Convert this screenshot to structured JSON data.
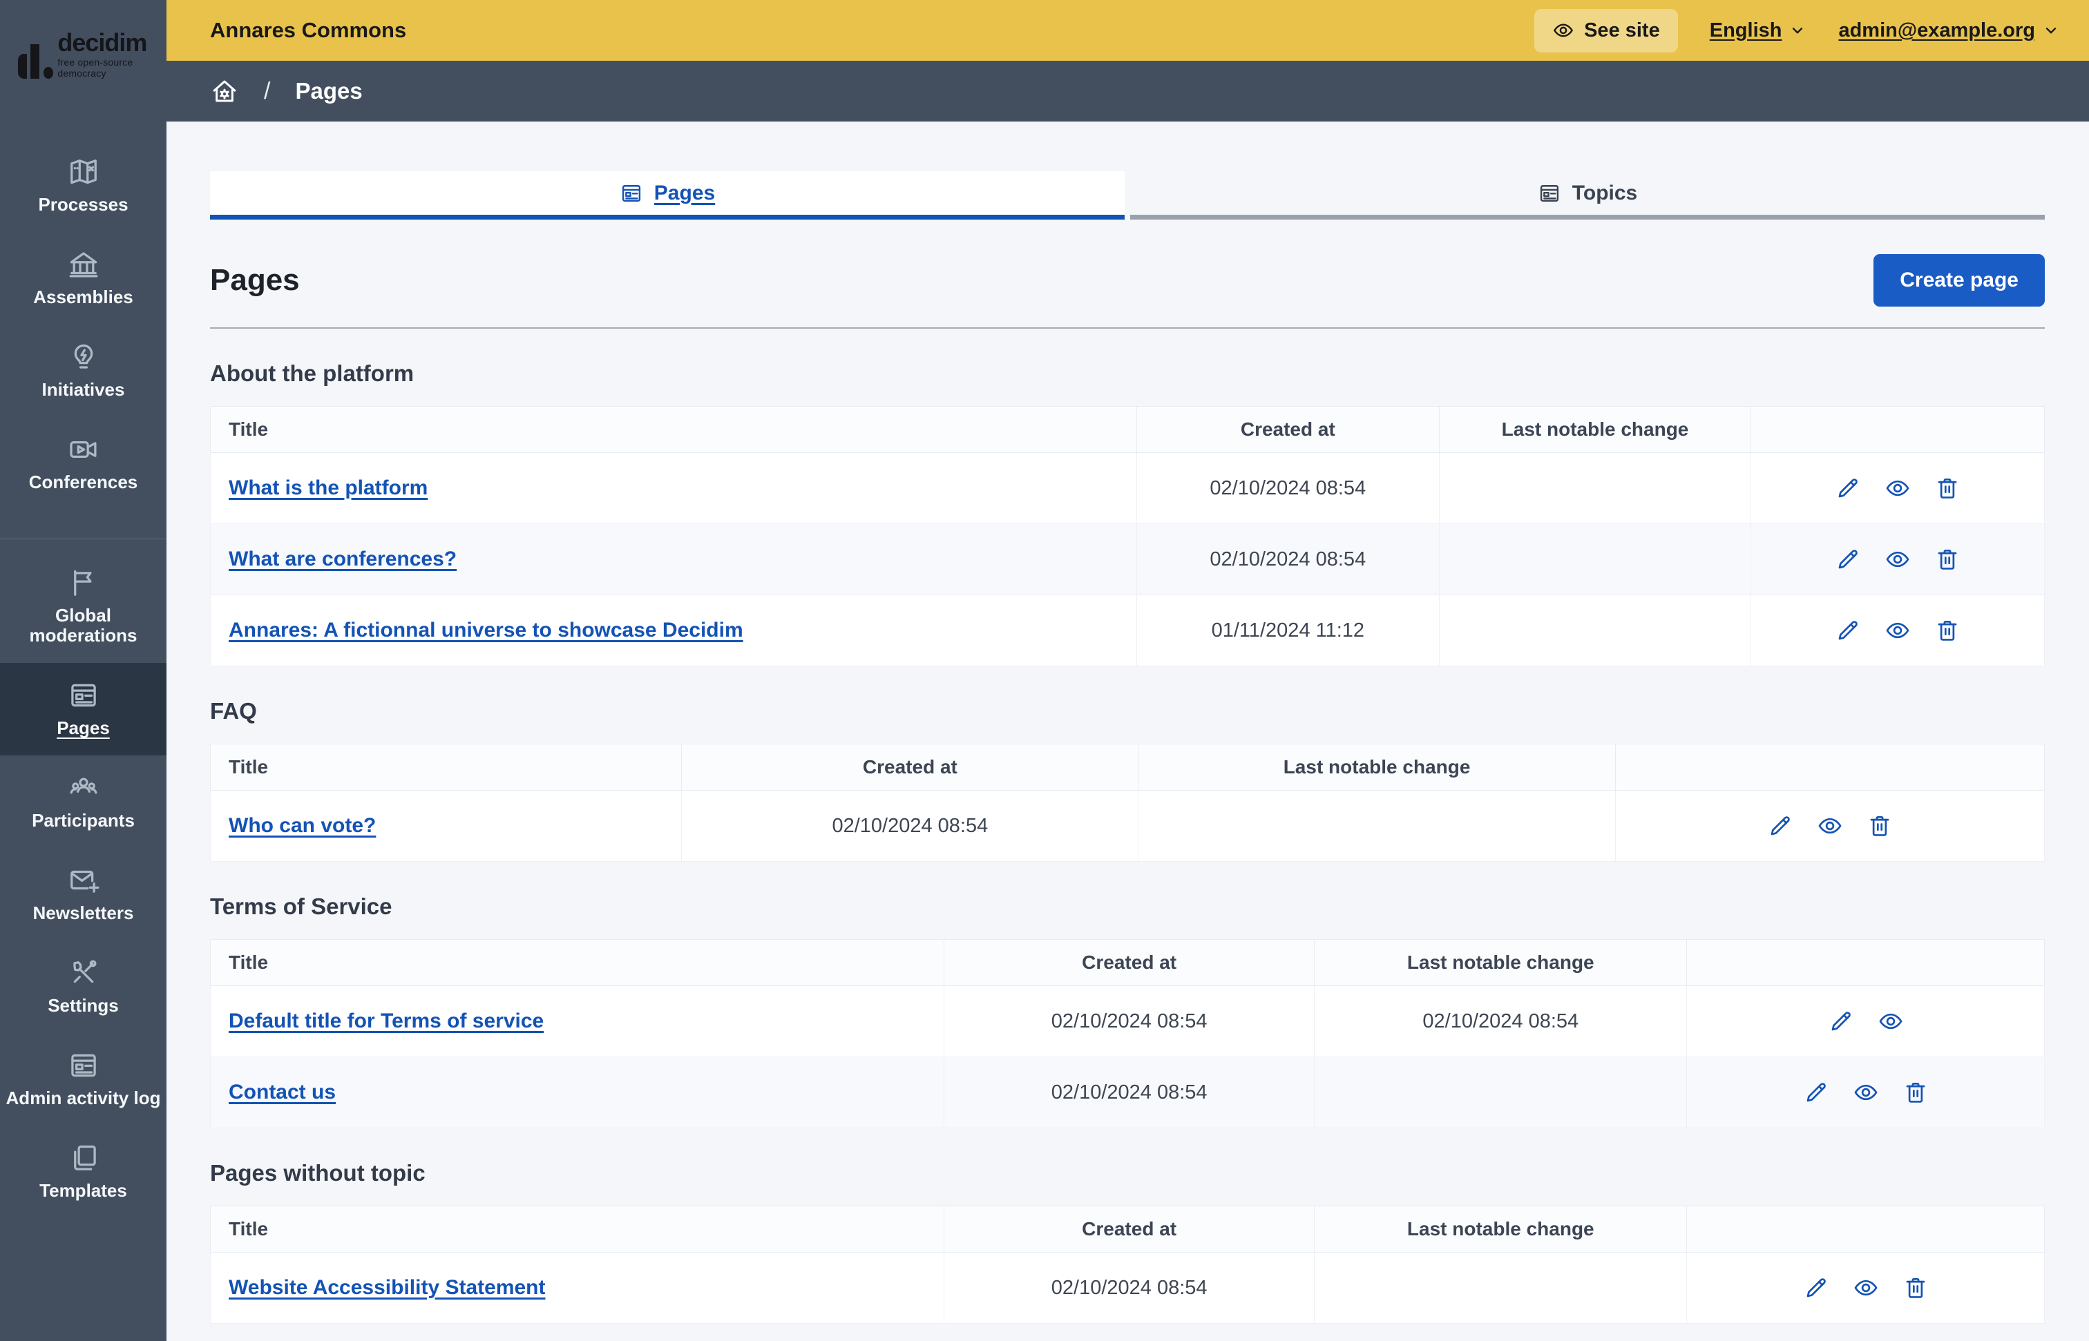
{
  "logo": {
    "brand": "decidim",
    "tagline": "free open-source democracy"
  },
  "topbar": {
    "title": "Annares Commons",
    "see_site_label": "See site",
    "language_label": "English",
    "user_label": "admin@example.org"
  },
  "breadcrumb": {
    "separator": "/",
    "current": "Pages"
  },
  "sidebar": {
    "groups": [
      [
        {
          "label": "Processes",
          "icon": "map-icon"
        },
        {
          "label": "Assemblies",
          "icon": "government-building-icon"
        },
        {
          "label": "Initiatives",
          "icon": "lightbulb-flash-icon"
        },
        {
          "label": "Conferences",
          "icon": "video-camera-icon"
        }
      ],
      [
        {
          "label": "Global moderations",
          "icon": "flag-icon"
        },
        {
          "label": "Pages",
          "icon": "article-icon",
          "active": true
        },
        {
          "label": "Participants",
          "icon": "team-icon"
        },
        {
          "label": "Newsletters",
          "icon": "mail-add-icon"
        },
        {
          "label": "Settings",
          "icon": "tools-icon"
        },
        {
          "label": "Admin activity log",
          "icon": "article-icon"
        },
        {
          "label": "Templates",
          "icon": "file-copy-icon"
        }
      ]
    ]
  },
  "tabs": [
    {
      "label": "Pages",
      "icon": "article-icon",
      "active": true
    },
    {
      "label": "Topics",
      "icon": "article-icon",
      "active": false
    }
  ],
  "page": {
    "title": "Pages",
    "create_button_label": "Create page"
  },
  "columns": {
    "title": "Title",
    "created_at": "Created at",
    "last_change": "Last notable change"
  },
  "sections": [
    {
      "title": "About the platform",
      "rows": [
        {
          "title": "What is the platform",
          "created_at": "02/10/2024 08:54",
          "last_change": "",
          "actions": [
            "edit-icon",
            "preview-icon",
            "delete-icon"
          ]
        },
        {
          "title": "What are conferences?",
          "created_at": "02/10/2024 08:54",
          "last_change": "",
          "actions": [
            "edit-icon",
            "preview-icon",
            "delete-icon"
          ]
        },
        {
          "title": "Annares: A fictionnal universe to showcase Decidim",
          "created_at": "01/11/2024 11:12",
          "last_change": "",
          "actions": [
            "edit-icon",
            "preview-icon",
            "delete-icon"
          ]
        }
      ]
    },
    {
      "title": "FAQ",
      "rows": [
        {
          "title": "Who can vote?",
          "created_at": "02/10/2024 08:54",
          "last_change": "",
          "actions": [
            "edit-icon",
            "preview-icon",
            "delete-icon"
          ]
        }
      ]
    },
    {
      "title": "Terms of Service",
      "rows": [
        {
          "title": "Default title for Terms of service",
          "created_at": "02/10/2024 08:54",
          "last_change": "02/10/2024 08:54",
          "actions": [
            "edit-icon",
            "preview-icon"
          ]
        },
        {
          "title": "Contact us",
          "created_at": "02/10/2024 08:54",
          "last_change": "",
          "actions": [
            "edit-icon",
            "preview-icon",
            "delete-icon"
          ]
        }
      ]
    },
    {
      "title": "Pages without topic",
      "rows": [
        {
          "title": "Website Accessibility Statement",
          "created_at": "02/10/2024 08:54",
          "last_change": "",
          "actions": [
            "edit-icon",
            "preview-icon",
            "delete-icon"
          ]
        }
      ]
    }
  ],
  "colors": {
    "topbar_yellow": "#e9c24b",
    "sidebar_slate": "#434f5f",
    "sidebar_active": "#2b3644",
    "primary_blue": "#1353b5",
    "button_blue": "#1a5cc6",
    "page_background": "#f4f6f9",
    "inactive_tab_border": "#9aa1ac"
  }
}
